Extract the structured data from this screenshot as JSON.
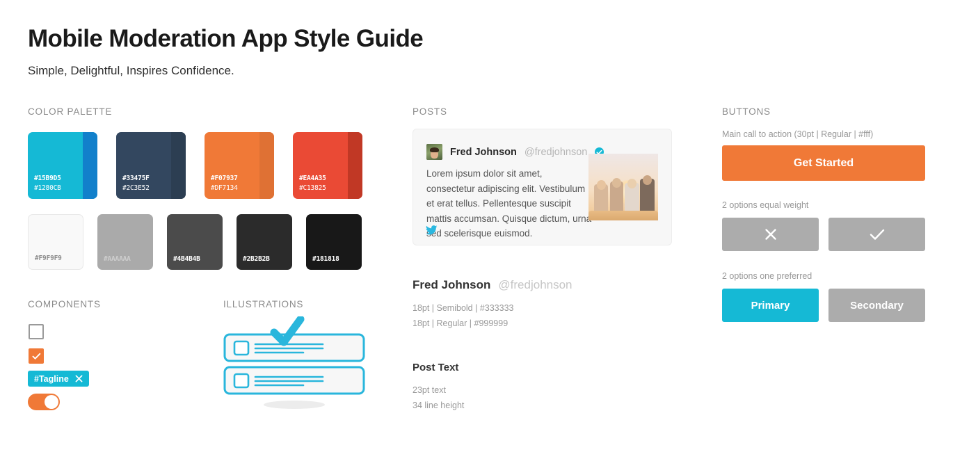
{
  "header": {
    "title": "Mobile Moderation App Style Guide",
    "subtitle": "Simple, Delightful, Inspires Confidence."
  },
  "sections": {
    "palette": "COLOR PALETTE",
    "components": "COMPONENTS",
    "illustrations": "ILLUSTRATIONS",
    "posts": "POSTS",
    "buttons": "BUTTONS"
  },
  "palette": {
    "brand": [
      {
        "main": "#15B9D5",
        "shade": "#1280CB",
        "label_main": "#15B9D5",
        "label_shade": "#1280CB",
        "text_color": "#ffffff"
      },
      {
        "main": "#33475F",
        "shade": "#2C3E52",
        "label_main": "#33475F",
        "label_shade": "#2C3E52",
        "text_color": "#ffffff"
      },
      {
        "main": "#F07937",
        "shade": "#DF7134",
        "label_main": "#F07937",
        "label_shade": "#DF7134",
        "text_color": "#ffffff"
      },
      {
        "main": "#EA4A35",
        "shade": "#C13825",
        "label_main": "#EA4A35",
        "label_shade": "#C13825",
        "text_color": "#ffffff"
      }
    ],
    "grays": [
      {
        "main": "#F9F9F9",
        "label": "#F9F9F9",
        "text_color": "#8d8d8d",
        "bordered": true
      },
      {
        "main": "#AAAAAA",
        "label": "#AAAAAA",
        "text_color": "#cfcfcf",
        "bordered": false
      },
      {
        "main": "#4B4B4B",
        "label": "#4B4B4B",
        "text_color": "#ffffff",
        "bordered": false
      },
      {
        "main": "#2B2B2B",
        "label": "#2B2B2B",
        "text_color": "#ffffff",
        "bordered": false
      },
      {
        "main": "#181818",
        "label": "#181818",
        "text_color": "#ffffff",
        "bordered": false
      }
    ]
  },
  "components": {
    "checkbox_empty": "checkbox-unchecked",
    "checkbox_checked": "checkbox-checked",
    "tag_label": "#Tagline",
    "tag_close": "close-icon",
    "toggle_state": "on"
  },
  "post": {
    "name": "Fred Johnson",
    "handle": "@fredjohnson",
    "verified": true,
    "body": "Lorem ipsum dolor sit amet, consectetur adipiscing elit. Vestibulum et erat tellus. Pellentesque suscipit mattis accumsan. Quisque dictum, urna sed scelerisque euismod.",
    "share_icon": "twitter-icon"
  },
  "typography": {
    "sample_name": "Fred Johnson",
    "sample_handle": "@fredjohnson",
    "spec_name": "18pt | Semibold | #333333",
    "spec_handle": "18pt | Regular | #999999",
    "post_text_title": "Post Text",
    "post_text_size": "23pt text",
    "post_text_leading": "34 line height"
  },
  "buttons": {
    "cta_caption": "Main call to action (30pt | Regular | #fff)",
    "cta_label": "Get Started",
    "equal_caption": "2 options equal weight",
    "reject_icon": "close-icon",
    "accept_icon": "check-icon",
    "preferred_caption": "2 options one preferred",
    "primary_label": "Primary",
    "secondary_label": "Secondary"
  },
  "colors": {
    "cyan": "#15B9D5",
    "orange": "#F07937",
    "gray_button": "#ACACAC"
  }
}
